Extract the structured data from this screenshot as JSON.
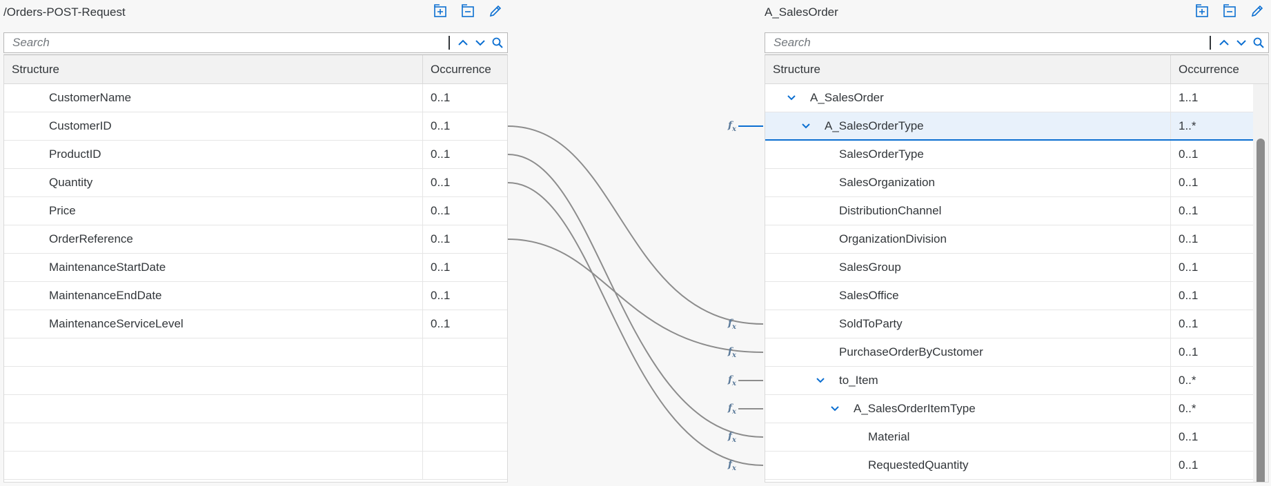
{
  "source": {
    "title": "/Orders-POST-Request",
    "search_placeholder": "Search",
    "columns": {
      "structure": "Structure",
      "occurrence": "Occurrence"
    },
    "rows": [
      {
        "name": "CustomerName",
        "occ": "0..1"
      },
      {
        "name": "CustomerID",
        "occ": "0..1"
      },
      {
        "name": "ProductID",
        "occ": "0..1"
      },
      {
        "name": "Quantity",
        "occ": "0..1"
      },
      {
        "name": "Price",
        "occ": "0..1"
      },
      {
        "name": "OrderReference",
        "occ": "0..1"
      },
      {
        "name": "MaintenanceStartDate",
        "occ": "0..1"
      },
      {
        "name": "MaintenanceEndDate",
        "occ": "0..1"
      },
      {
        "name": "MaintenanceServiceLevel",
        "occ": "0..1"
      }
    ]
  },
  "target": {
    "title": "A_SalesOrder",
    "search_placeholder": "Search",
    "columns": {
      "structure": "Structure",
      "occurrence": "Occurrence"
    },
    "rows": [
      {
        "name": "A_SalesOrder",
        "occ": "1..1"
      },
      {
        "name": "A_SalesOrderType",
        "occ": "1..*"
      },
      {
        "name": "SalesOrderType",
        "occ": "0..1"
      },
      {
        "name": "SalesOrganization",
        "occ": "0..1"
      },
      {
        "name": "DistributionChannel",
        "occ": "0..1"
      },
      {
        "name": "OrganizationDivision",
        "occ": "0..1"
      },
      {
        "name": "SalesGroup",
        "occ": "0..1"
      },
      {
        "name": "SalesOffice",
        "occ": "0..1"
      },
      {
        "name": "SoldToParty",
        "occ": "0..1"
      },
      {
        "name": "PurchaseOrderByCustomer",
        "occ": "0..1"
      },
      {
        "name": "to_Item",
        "occ": "0..*"
      },
      {
        "name": "A_SalesOrderItemType",
        "occ": "0..*"
      },
      {
        "name": "Material",
        "occ": "0..1"
      },
      {
        "name": "RequestedQuantity",
        "occ": "0..1"
      }
    ]
  },
  "function_symbol": "f",
  "function_symbol_sub": "x",
  "colors": {
    "accent": "#0a6ed1",
    "link": "#8c8c8c",
    "selected_row": "#e8f1fb"
  },
  "icons": [
    "expand-all-icon",
    "collapse-all-icon",
    "edit-icon",
    "chevron-up-icon",
    "chevron-down-icon",
    "search-icon",
    "expand-chevron-icon"
  ]
}
